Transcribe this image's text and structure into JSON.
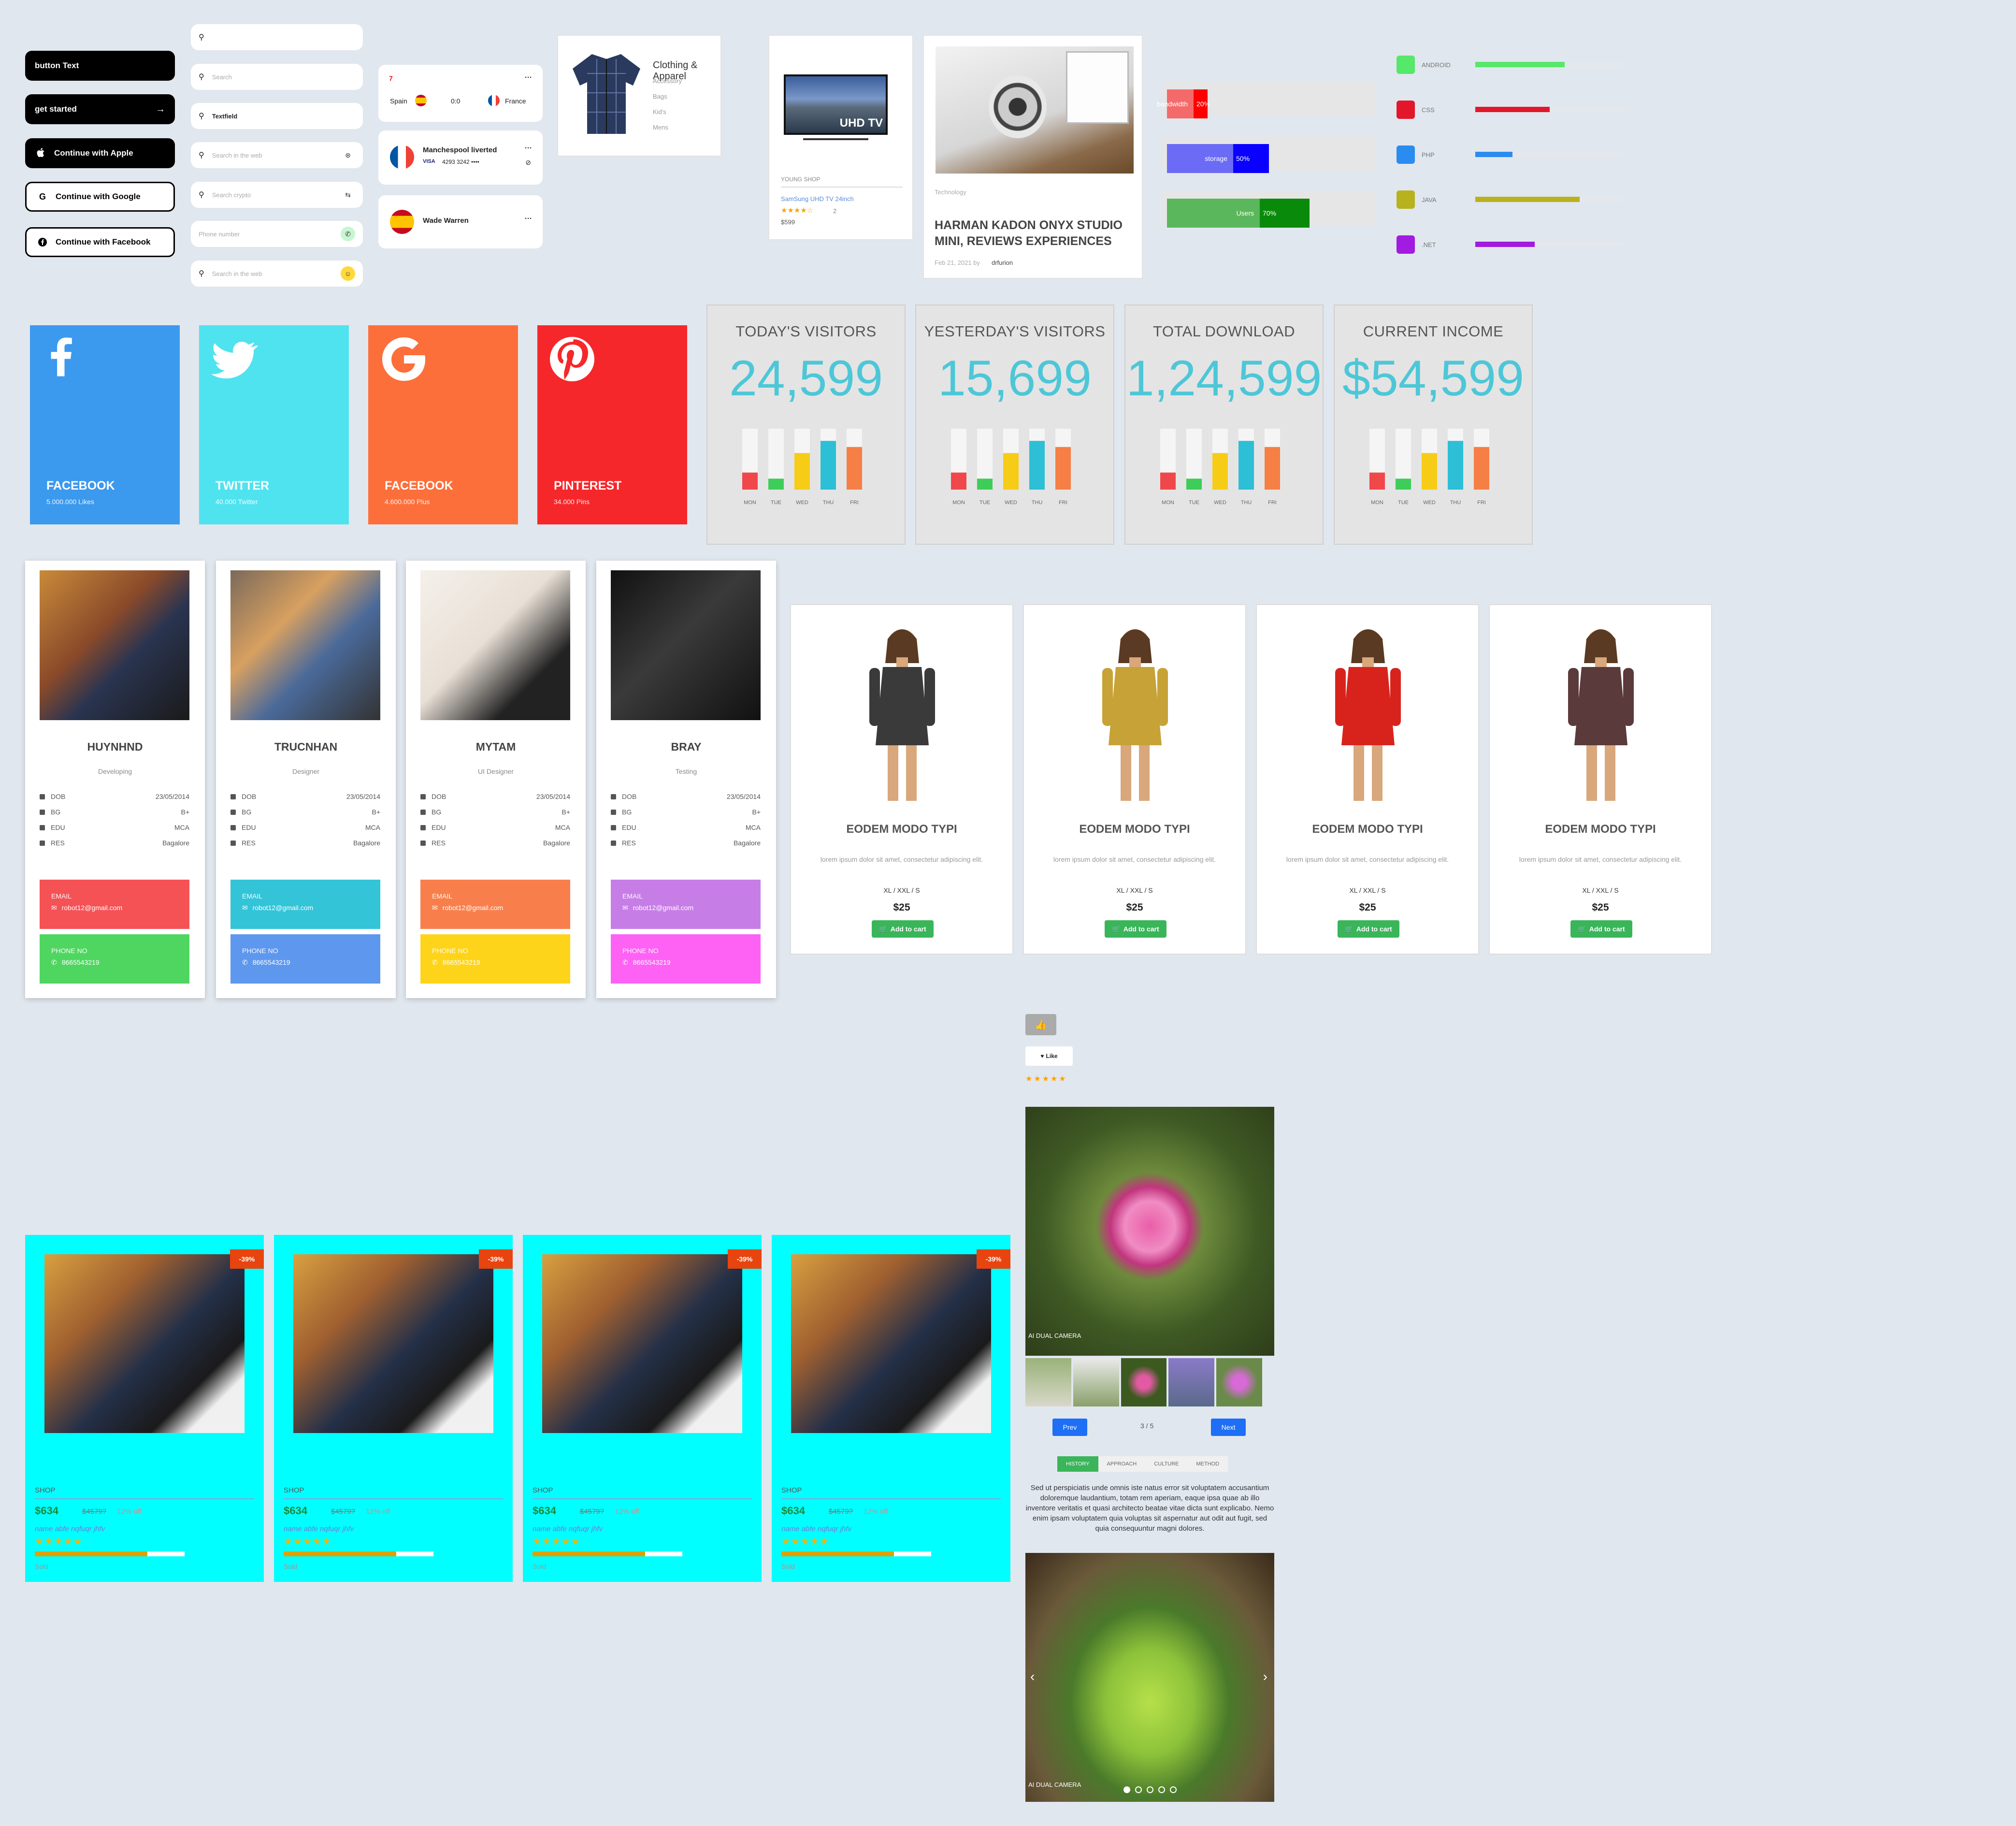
{
  "buttons": [
    {
      "label": "button Text",
      "style": "dark"
    },
    {
      "label": "get started",
      "style": "dark",
      "icon": "arrow-right-icon"
    },
    {
      "label": "Continue with Apple",
      "style": "dark",
      "icon": "apple-icon"
    },
    {
      "label": "Continue with Google",
      "style": "light",
      "icon": "google-icon"
    },
    {
      "label": "Continue with Facebook",
      "style": "light",
      "icon": "facebook-icon"
    }
  ],
  "inputs": [
    {
      "placeholder": ""
    },
    {
      "placeholder": "Search"
    },
    {
      "value": "Textfield"
    },
    {
      "placeholder": "Search in the web"
    },
    {
      "placeholder": "Search crypto"
    },
    {
      "placeholder": "Phone number"
    },
    {
      "placeholder": "Search in the web"
    }
  ],
  "match": {
    "team1": "Spain",
    "score": "0:0",
    "team2": "France",
    "more": "···"
  },
  "account": {
    "name": "Manchespool liverted",
    "card_brand": "VISA",
    "card_number": "4293 3242 ••••",
    "more": "···"
  },
  "contact": {
    "name": "Wade Warren",
    "more": "···"
  },
  "category_card": {
    "title": "Clothing & Apparel",
    "items": [
      "Accessory",
      "Bags",
      "Kid's",
      "Mens"
    ]
  },
  "tv_card": {
    "screen_text": "UHD TV",
    "shop": "YOUNG SHOP",
    "title": "SamSung UHD TV 24inch",
    "stars": "★★★★☆",
    "reviews": "2",
    "price": "$599"
  },
  "blog_card": {
    "category": "Technology",
    "title": "HARMAN KADON ONYX STUDIO MINI, REVIEWS EXPERIENCES",
    "date": "Feb 21, 2021 by",
    "author": "drfurion"
  },
  "progress_bars": [
    {
      "label": "bandwidth",
      "percent": "20%",
      "value": 0.2,
      "color": "#ff0000",
      "light": "#f46a6a"
    },
    {
      "label": "storage",
      "percent": "50%",
      "value": 0.5,
      "color": "#0a00ff",
      "light": "#6b6bf5"
    },
    {
      "label": "Users",
      "percent": "70%",
      "value": 0.7,
      "color": "#0a8a0a",
      "light": "#5bb75b"
    }
  ],
  "skills": [
    {
      "label": "ANDROID",
      "value": 0.6,
      "color": "#55e86a"
    },
    {
      "label": "CSS",
      "value": 0.5,
      "color": "#e2182a"
    },
    {
      "label": "PHP",
      "value": 0.25,
      "color": "#2b8cf0"
    },
    {
      "label": "JAVA",
      "value": 0.7,
      "color": "#b8b21e"
    },
    {
      "label": ".NET",
      "value": 0.4,
      "color": "#a11be0"
    }
  ],
  "social": [
    {
      "name": "FACEBOOK",
      "sub": "5.000.000 Likes",
      "color": "#3b99ee",
      "icon": "facebook-icon"
    },
    {
      "name": "TWITTER",
      "sub": "40.000 Twitter",
      "color": "#4fe3ef",
      "icon": "twitter-icon"
    },
    {
      "name": "FACEBOOK",
      "sub": "4.600.000 Plus",
      "color": "#fd6f3a",
      "icon": "google-icon"
    },
    {
      "name": "PINTEREST",
      "sub": "34.000 Pins",
      "color": "#f6272a",
      "icon": "pinterest-icon"
    }
  ],
  "stats": [
    {
      "title": "TODAY'S VISITORS",
      "value": "24,599"
    },
    {
      "title": "YESTERDAY'S VISITORS",
      "value": "15,699"
    },
    {
      "title": "TOTAL DOWNLOAD",
      "value": "1,24,599"
    },
    {
      "title": "CURRENT INCOME",
      "value": "$54,599"
    }
  ],
  "stat_chart": {
    "days": [
      "MON",
      "TUE",
      "WED",
      "THU",
      "FRI"
    ],
    "levels": [
      0.28,
      0.18,
      0.6,
      0.8,
      0.7
    ],
    "colors": [
      "#f0474a",
      "#3fcd5a",
      "#f6cc17",
      "#2dbfd6",
      "#f57f45"
    ]
  },
  "profiles": [
    {
      "name": "HUYNHND",
      "role": "Developing",
      "dob": "23/05/2014",
      "bg": "B+",
      "edu": "MCA",
      "res": "Bagalore",
      "email": "robot12@gmail.com",
      "phone": "8665543219",
      "c1": "#f55256",
      "c2": "#4fd660"
    },
    {
      "name": "TRUCNHAN",
      "role": "Designer",
      "dob": "23/05/2014",
      "bg": "B+",
      "edu": "MCA",
      "res": "Bagalore",
      "email": "robot12@gmail.com",
      "phone": "8665543219",
      "c1": "#33c4d8",
      "c2": "#5e98ee"
    },
    {
      "name": "MYTAM",
      "role": "UI Designer",
      "dob": "23/05/2014",
      "bg": "B+",
      "edu": "MCA",
      "res": "Bagalore",
      "email": "robot12@gmail.com",
      "phone": "8665543219",
      "c1": "#f87f4c",
      "c2": "#fdd419"
    },
    {
      "name": "BRAY",
      "role": "Testing",
      "dob": "23/05/2014",
      "bg": "B+",
      "edu": "MCA",
      "res": "Bagalore",
      "email": "robot12@gmail.com",
      "phone": "8665543219",
      "c1": "#c77de6",
      "c2": "#fd62f5"
    }
  ],
  "profile_labels": {
    "dob": "DOB",
    "bg": "BG",
    "edu": "EDU",
    "res": "RES",
    "email": "EMAIL",
    "phone": "PHONE NO"
  },
  "products": [
    {
      "title": "EODEM MODO TYPI",
      "desc": "lorem ipsum dolor sit amet, consectetur adipiscing elit.",
      "sizes": "XL / XXL / S",
      "price": "$25",
      "cta": "Add to cart",
      "dress": "#3a3a3a"
    },
    {
      "title": "EODEM MODO TYPI",
      "desc": "lorem ipsum dolor sit amet, consectetur adipiscing elit.",
      "sizes": "XL / XXL / S",
      "price": "$25",
      "cta": "Add to cart",
      "dress": "#c7a236"
    },
    {
      "title": "EODEM MODO TYPI",
      "desc": "lorem ipsum dolor sit amet, consectetur adipiscing elit.",
      "sizes": "XL / XXL / S",
      "price": "$25",
      "cta": "Add to cart",
      "dress": "#d8231d"
    },
    {
      "title": "EODEM MODO TYPI",
      "desc": "lorem ipsum dolor sit amet, consectetur adipiscing elit.",
      "sizes": "XL / XXL / S",
      "price": "$25",
      "cta": "Add to cart",
      "dress": "#5a3a3a"
    }
  ],
  "shop_cards": [
    {
      "badge": "-39%",
      "shop": "SHOP",
      "price": "$634",
      "old": "$4579?",
      "off": "12% off",
      "name": "name abfe nqfuqr jhfv",
      "stars": "★★★★★",
      "sold": 0.75,
      "sold_text": "Sold"
    },
    {
      "badge": "-39%",
      "shop": "SHOP",
      "price": "$634",
      "old": "$4579?",
      "off": "12% off",
      "name": "name abfe nqfuqr jhfv",
      "stars": "★★★★★",
      "sold": 0.75,
      "sold_text": "Sold"
    },
    {
      "badge": "-39%",
      "shop": "SHOP",
      "price": "$634",
      "old": "$4579?",
      "off": "12% off",
      "name": "name abfe nqfuqr jhfv",
      "stars": "★★★★★",
      "sold": 0.75,
      "sold_text": "Sold"
    },
    {
      "badge": "-39%",
      "shop": "SHOP",
      "price": "$634",
      "old": "$4579?",
      "off": "12% off",
      "name": "name abfe nqfuqr jhfv",
      "stars": "★★★★★",
      "sold": 0.75,
      "sold_text": "Sold"
    }
  ],
  "misc": {
    "like_label": "Like",
    "stars": "★★★★★"
  },
  "gallery": {
    "caption": "AI DUAL CAMERA",
    "prev": "Prev",
    "next": "Next",
    "page": "3 / 5"
  },
  "tabs": {
    "items": [
      "HISTORY",
      "APPROACH",
      "CULTURE",
      "METHOD"
    ],
    "active": 0,
    "text": "Sed ut perspiciatis unde omnis iste natus error sit voluptatem accusantium doloremque laudantium, totam rem aperiam, eaque ipsa quae ab illo inventore veritatis et quasi architecto beatae vitae dicta sunt explicabo. Nemo enim ipsam voluptatem quia voluptas sit aspernatur aut odit aut fugit, sed quia consequuntur magni dolores."
  },
  "carousel": {
    "caption": "AI DUAL CAMERA",
    "dots": 5,
    "active": 0
  }
}
